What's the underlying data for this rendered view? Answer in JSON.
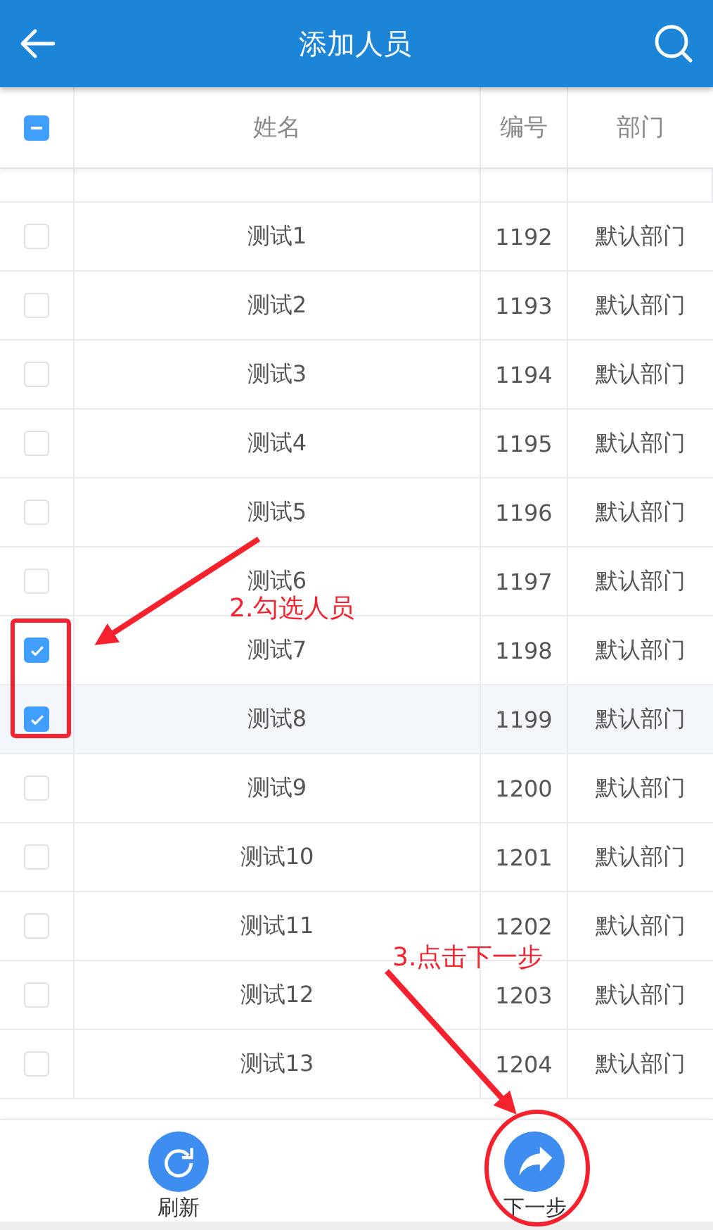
{
  "header": {
    "title": "添加人员"
  },
  "table": {
    "select_all": {
      "indeterminate": true
    },
    "columns": [
      "姓名",
      "编号",
      "部门"
    ],
    "rows": [
      {
        "name": "测试1",
        "number": "1192",
        "department": "默认部门",
        "checked": false,
        "selected": false
      },
      {
        "name": "测试2",
        "number": "1193",
        "department": "默认部门",
        "checked": false,
        "selected": false
      },
      {
        "name": "测试3",
        "number": "1194",
        "department": "默认部门",
        "checked": false,
        "selected": false
      },
      {
        "name": "测试4",
        "number": "1195",
        "department": "默认部门",
        "checked": false,
        "selected": false
      },
      {
        "name": "测试5",
        "number": "1196",
        "department": "默认部门",
        "checked": false,
        "selected": false
      },
      {
        "name": "测试6",
        "number": "1197",
        "department": "默认部门",
        "checked": false,
        "selected": false
      },
      {
        "name": "测试7",
        "number": "1198",
        "department": "默认部门",
        "checked": true,
        "selected": false
      },
      {
        "name": "测试8",
        "number": "1199",
        "department": "默认部门",
        "checked": true,
        "selected": true
      },
      {
        "name": "测试9",
        "number": "1200",
        "department": "默认部门",
        "checked": false,
        "selected": false
      },
      {
        "name": "测试10",
        "number": "1201",
        "department": "默认部门",
        "checked": false,
        "selected": false
      },
      {
        "name": "测试11",
        "number": "1202",
        "department": "默认部门",
        "checked": false,
        "selected": false
      },
      {
        "name": "测试12",
        "number": "1203",
        "department": "默认部门",
        "checked": false,
        "selected": false
      },
      {
        "name": "测试13",
        "number": "1204",
        "department": "默认部门",
        "checked": false,
        "selected": false
      }
    ]
  },
  "footer": {
    "buttons": [
      {
        "kind": "refresh",
        "label": "刷新"
      },
      {
        "kind": "next",
        "label": "下一步"
      }
    ]
  },
  "annotations": [
    {
      "kind": "step",
      "text": "2.勾选人员"
    },
    {
      "kind": "step",
      "text": "3.点击下一步"
    }
  ]
}
